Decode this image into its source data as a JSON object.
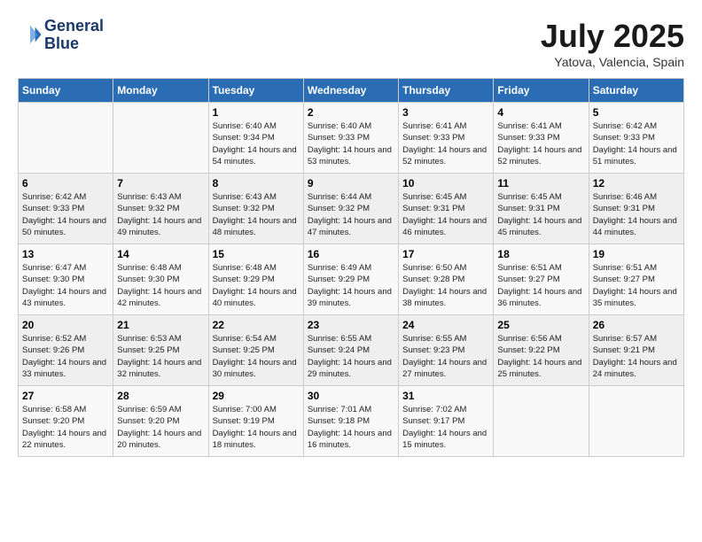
{
  "header": {
    "logo_line1": "General",
    "logo_line2": "Blue",
    "month_title": "July 2025",
    "location": "Yatova, Valencia, Spain"
  },
  "days_of_week": [
    "Sunday",
    "Monday",
    "Tuesday",
    "Wednesday",
    "Thursday",
    "Friday",
    "Saturday"
  ],
  "weeks": [
    [
      {
        "day": "",
        "sunrise": "",
        "sunset": "",
        "daylight": ""
      },
      {
        "day": "",
        "sunrise": "",
        "sunset": "",
        "daylight": ""
      },
      {
        "day": "1",
        "sunrise": "Sunrise: 6:40 AM",
        "sunset": "Sunset: 9:34 PM",
        "daylight": "Daylight: 14 hours and 54 minutes."
      },
      {
        "day": "2",
        "sunrise": "Sunrise: 6:40 AM",
        "sunset": "Sunset: 9:33 PM",
        "daylight": "Daylight: 14 hours and 53 minutes."
      },
      {
        "day": "3",
        "sunrise": "Sunrise: 6:41 AM",
        "sunset": "Sunset: 9:33 PM",
        "daylight": "Daylight: 14 hours and 52 minutes."
      },
      {
        "day": "4",
        "sunrise": "Sunrise: 6:41 AM",
        "sunset": "Sunset: 9:33 PM",
        "daylight": "Daylight: 14 hours and 52 minutes."
      },
      {
        "day": "5",
        "sunrise": "Sunrise: 6:42 AM",
        "sunset": "Sunset: 9:33 PM",
        "daylight": "Daylight: 14 hours and 51 minutes."
      }
    ],
    [
      {
        "day": "6",
        "sunrise": "Sunrise: 6:42 AM",
        "sunset": "Sunset: 9:33 PM",
        "daylight": "Daylight: 14 hours and 50 minutes."
      },
      {
        "day": "7",
        "sunrise": "Sunrise: 6:43 AM",
        "sunset": "Sunset: 9:32 PM",
        "daylight": "Daylight: 14 hours and 49 minutes."
      },
      {
        "day": "8",
        "sunrise": "Sunrise: 6:43 AM",
        "sunset": "Sunset: 9:32 PM",
        "daylight": "Daylight: 14 hours and 48 minutes."
      },
      {
        "day": "9",
        "sunrise": "Sunrise: 6:44 AM",
        "sunset": "Sunset: 9:32 PM",
        "daylight": "Daylight: 14 hours and 47 minutes."
      },
      {
        "day": "10",
        "sunrise": "Sunrise: 6:45 AM",
        "sunset": "Sunset: 9:31 PM",
        "daylight": "Daylight: 14 hours and 46 minutes."
      },
      {
        "day": "11",
        "sunrise": "Sunrise: 6:45 AM",
        "sunset": "Sunset: 9:31 PM",
        "daylight": "Daylight: 14 hours and 45 minutes."
      },
      {
        "day": "12",
        "sunrise": "Sunrise: 6:46 AM",
        "sunset": "Sunset: 9:31 PM",
        "daylight": "Daylight: 14 hours and 44 minutes."
      }
    ],
    [
      {
        "day": "13",
        "sunrise": "Sunrise: 6:47 AM",
        "sunset": "Sunset: 9:30 PM",
        "daylight": "Daylight: 14 hours and 43 minutes."
      },
      {
        "day": "14",
        "sunrise": "Sunrise: 6:48 AM",
        "sunset": "Sunset: 9:30 PM",
        "daylight": "Daylight: 14 hours and 42 minutes."
      },
      {
        "day": "15",
        "sunrise": "Sunrise: 6:48 AM",
        "sunset": "Sunset: 9:29 PM",
        "daylight": "Daylight: 14 hours and 40 minutes."
      },
      {
        "day": "16",
        "sunrise": "Sunrise: 6:49 AM",
        "sunset": "Sunset: 9:29 PM",
        "daylight": "Daylight: 14 hours and 39 minutes."
      },
      {
        "day": "17",
        "sunrise": "Sunrise: 6:50 AM",
        "sunset": "Sunset: 9:28 PM",
        "daylight": "Daylight: 14 hours and 38 minutes."
      },
      {
        "day": "18",
        "sunrise": "Sunrise: 6:51 AM",
        "sunset": "Sunset: 9:27 PM",
        "daylight": "Daylight: 14 hours and 36 minutes."
      },
      {
        "day": "19",
        "sunrise": "Sunrise: 6:51 AM",
        "sunset": "Sunset: 9:27 PM",
        "daylight": "Daylight: 14 hours and 35 minutes."
      }
    ],
    [
      {
        "day": "20",
        "sunrise": "Sunrise: 6:52 AM",
        "sunset": "Sunset: 9:26 PM",
        "daylight": "Daylight: 14 hours and 33 minutes."
      },
      {
        "day": "21",
        "sunrise": "Sunrise: 6:53 AM",
        "sunset": "Sunset: 9:25 PM",
        "daylight": "Daylight: 14 hours and 32 minutes."
      },
      {
        "day": "22",
        "sunrise": "Sunrise: 6:54 AM",
        "sunset": "Sunset: 9:25 PM",
        "daylight": "Daylight: 14 hours and 30 minutes."
      },
      {
        "day": "23",
        "sunrise": "Sunrise: 6:55 AM",
        "sunset": "Sunset: 9:24 PM",
        "daylight": "Daylight: 14 hours and 29 minutes."
      },
      {
        "day": "24",
        "sunrise": "Sunrise: 6:55 AM",
        "sunset": "Sunset: 9:23 PM",
        "daylight": "Daylight: 14 hours and 27 minutes."
      },
      {
        "day": "25",
        "sunrise": "Sunrise: 6:56 AM",
        "sunset": "Sunset: 9:22 PM",
        "daylight": "Daylight: 14 hours and 25 minutes."
      },
      {
        "day": "26",
        "sunrise": "Sunrise: 6:57 AM",
        "sunset": "Sunset: 9:21 PM",
        "daylight": "Daylight: 14 hours and 24 minutes."
      }
    ],
    [
      {
        "day": "27",
        "sunrise": "Sunrise: 6:58 AM",
        "sunset": "Sunset: 9:20 PM",
        "daylight": "Daylight: 14 hours and 22 minutes."
      },
      {
        "day": "28",
        "sunrise": "Sunrise: 6:59 AM",
        "sunset": "Sunset: 9:20 PM",
        "daylight": "Daylight: 14 hours and 20 minutes."
      },
      {
        "day": "29",
        "sunrise": "Sunrise: 7:00 AM",
        "sunset": "Sunset: 9:19 PM",
        "daylight": "Daylight: 14 hours and 18 minutes."
      },
      {
        "day": "30",
        "sunrise": "Sunrise: 7:01 AM",
        "sunset": "Sunset: 9:18 PM",
        "daylight": "Daylight: 14 hours and 16 minutes."
      },
      {
        "day": "31",
        "sunrise": "Sunrise: 7:02 AM",
        "sunset": "Sunset: 9:17 PM",
        "daylight": "Daylight: 14 hours and 15 minutes."
      },
      {
        "day": "",
        "sunrise": "",
        "sunset": "",
        "daylight": ""
      },
      {
        "day": "",
        "sunrise": "",
        "sunset": "",
        "daylight": ""
      }
    ]
  ]
}
